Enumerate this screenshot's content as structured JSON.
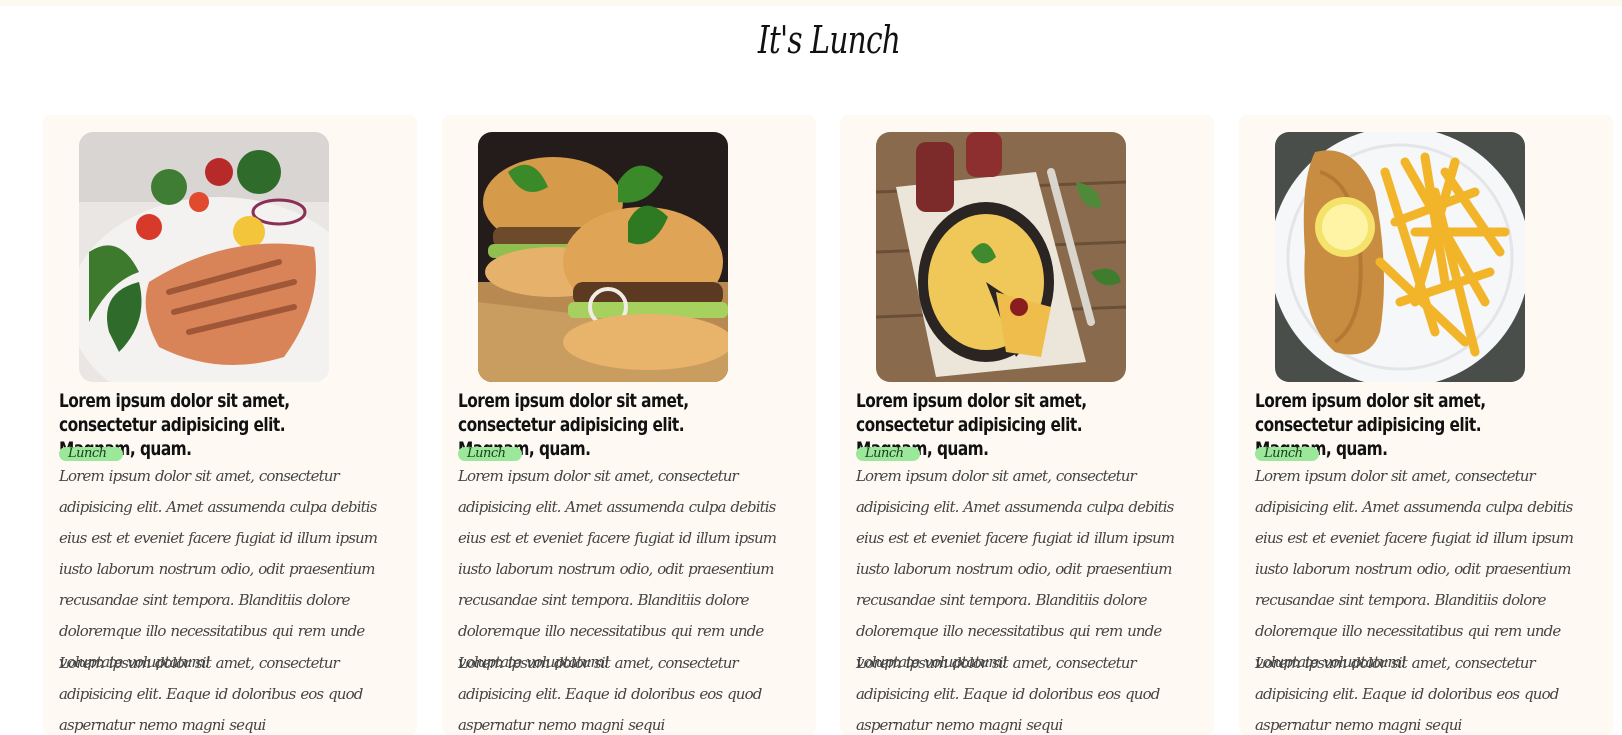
{
  "page": {
    "title": "It's Lunch"
  },
  "cards": [
    {
      "image_icon": "salmon-salad-image",
      "title": "Lorem ipsum dolor sit amet, consectetur adipisicing elit. Magnam, quam.",
      "tag": "Lunch",
      "paragraph_1": "Lorem ipsum dolor sit amet, consectetur adipisicing elit. Amet assumenda culpa debitis eius est et eveniet facere fugiat id illum ipsum iusto laborum nostrum odio, odit praesentium recusandae sint tempora. Blanditiis dolore doloremque illo necessitatibus qui rem unde voluptate voluptatum!",
      "paragraph_2": "Lorem ipsum dolor sit amet, consectetur adipisicing elit. Eaque id doloribus eos quod aspernatur nemo magni sequi"
    },
    {
      "image_icon": "burger-image",
      "title": "Lorem ipsum dolor sit amet, consectetur adipisicing elit. Magnam, quam.",
      "tag": "Lunch",
      "paragraph_1": "Lorem ipsum dolor sit amet, consectetur adipisicing elit. Amet assumenda culpa debitis eius est et eveniet facere fugiat id illum ipsum iusto laborum nostrum odio, odit praesentium recusandae sint tempora. Blanditiis dolore doloremque illo necessitatibus qui rem unde voluptate voluptatum!",
      "paragraph_2": "Lorem ipsum dolor sit amet, consectetur adipisicing elit. Eaque id doloribus eos quod aspernatur nemo magni sequi"
    },
    {
      "image_icon": "omelette-pie-image",
      "title": "Lorem ipsum dolor sit amet, consectetur adipisicing elit. Magnam, quam.",
      "tag": "Lunch",
      "paragraph_1": "Lorem ipsum dolor sit amet, consectetur adipisicing elit. Amet assumenda culpa debitis eius est et eveniet facere fugiat id illum ipsum iusto laborum nostrum odio, odit praesentium recusandae sint tempora. Blanditiis dolore doloremque illo necessitatibus qui rem unde voluptate voluptatum!",
      "paragraph_2": "Lorem ipsum dolor sit amet, consectetur adipisicing elit. Eaque id doloribus eos quod aspernatur nemo magni sequi"
    },
    {
      "image_icon": "schnitzel-fries-image",
      "title": "Lorem ipsum dolor sit amet, consectetur adipisicing elit. Magnam, quam.",
      "tag": "Lunch",
      "paragraph_1": "Lorem ipsum dolor sit amet, consectetur adipisicing elit. Amet assumenda culpa debitis eius est et eveniet facere fugiat id illum ipsum iusto laborum nostrum odio, odit praesentium recusandae sint tempora. Blanditiis dolore doloremque illo necessitatibus qui rem unde voluptate voluptatum!",
      "paragraph_2": "Lorem ipsum dolor sit amet, consectetur adipisicing elit. Eaque id doloribus eos quod aspernatur nemo magni sequi"
    }
  ],
  "colors": {
    "card_background": "#fefaf3",
    "tag_background": "#9be89b",
    "title_text": "#111111",
    "body_text": "#444444"
  }
}
